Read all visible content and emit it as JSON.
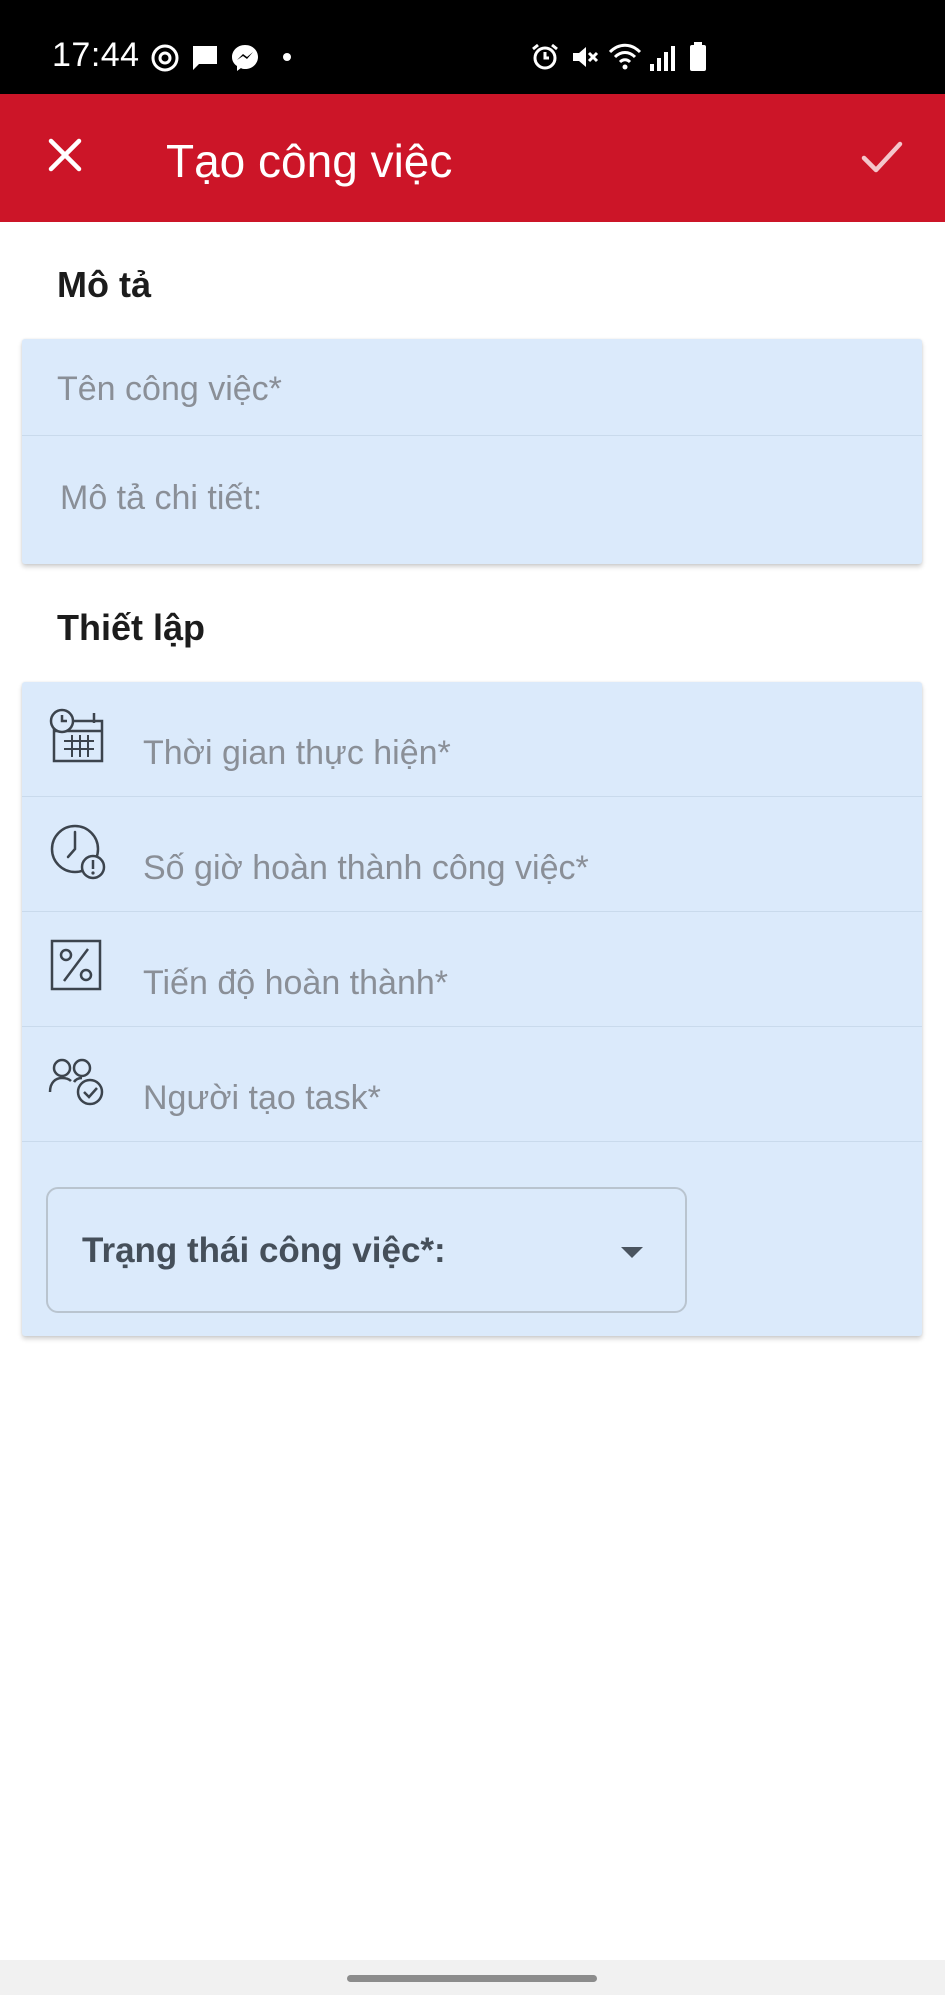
{
  "status_bar": {
    "time": "17:44",
    "icons": [
      "target-icon",
      "chat-icon",
      "messenger-icon",
      "dot-icon",
      "alarm-icon",
      "mute-icon",
      "wifi-icon",
      "signal-icon",
      "battery-icon"
    ]
  },
  "app_bar": {
    "title": "Tạo công việc",
    "close_icon": "close-icon",
    "confirm_icon": "check-icon",
    "background": "#cc1528"
  },
  "description_section": {
    "title": "Mô tả",
    "fields": [
      {
        "placeholder": "Tên công việc*"
      },
      {
        "placeholder": "Mô tả chi tiết:"
      }
    ]
  },
  "settings_section": {
    "title": "Thiết lập",
    "fields": [
      {
        "icon": "calendar-clock-icon",
        "placeholder": "Thời gian thực hiện*"
      },
      {
        "icon": "clock-alert-icon",
        "placeholder": "Số giờ hoàn thành công việc*"
      },
      {
        "icon": "percent-icon",
        "placeholder": "Tiến độ hoàn thành*"
      },
      {
        "icon": "people-check-icon",
        "placeholder": "Người tạo task*"
      }
    ],
    "status_select": {
      "label": "Trạng thái công việc*:",
      "icon": "dropdown-arrow-icon"
    }
  },
  "colors": {
    "accent": "#cc1528",
    "card_background": "#dbeafb",
    "placeholder_text": "#8a8f97"
  }
}
